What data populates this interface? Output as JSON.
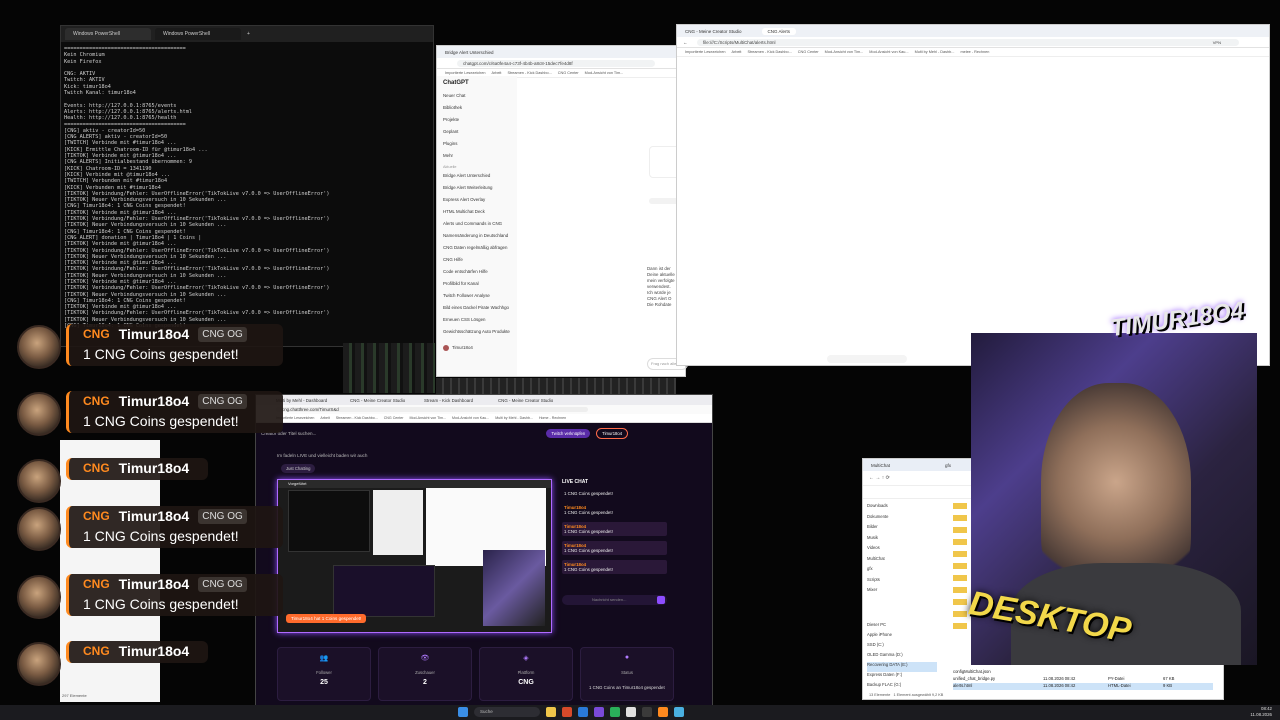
{
  "powershell": {
    "tab1": "Windows PowerShell",
    "tab2": "Windows PowerShell",
    "lines": "=======================================\nKein Chromium\nKein Firefox\n\nCNG: AKTIV\nTwitch: AKTIV\nKick: timur18o4\nTwitch Kanal: timur18o4\n\nEvents: http://127.0.0.1:8765/events\nAlerts: http://127.0.0.1:8765/alerts.html\nHealth: http://127.0.0.1:8765/health\n=======================================\n[CNG] aktiv - creatorId=50\n[CNG ALERTS] aktiv - creatorId=50\n[TWITCH] Verbinde mit #timur18o4 ...\n[KICK] Ermittle Chatroom-ID für @timur18o4 ...\n[TIKTOK] Verbinde mit @timur18o4 ...\n[CNG ALERTS] Initialbestand übernommen: 9\n[KICK] Chatroom-ID = 1341190\n[KICK] Verbinde mit @timur18o4 ...\n[TWITCH] Verbunden mit #timur18o4\n[KICK] Verbunden mit #timur18o4\n[TIKTOK] Verbindung/Fehler: UserOfflineError('TikTokLive v7.0.0 => UserOfflineError')\n[TIKTOK] Neuer Verbindungsversuch in 10 Sekunden ...\n[CNG] Timur18o4: 1 CNG Coins gespendet!\n[TIKTOK] Verbinde mit @timur18o4 ...\n[TIKTOK] Verbindung/Fehler: UserOfflineError('TikTokLive v7.0.0 => UserOfflineError')\n[TIKTOK] Neuer Verbindungsversuch in 10 Sekunden ...\n[CNG] Timur18o4: 1 CNG Coins gespendet!\n[CNG ALERT] donation | Timur18o4 | 1 Coins |\n[TIKTOK] Verbinde mit @timur18o4 ...\n[TIKTOK] Verbindung/Fehler: UserOfflineError('TikTokLive v7.0.0 => UserOfflineError')\n[TIKTOK] Neuer Verbindungsversuch in 10 Sekunden ...\n[TIKTOK] Verbinde mit @timur18o4 ...\n[TIKTOK] Verbindung/Fehler: UserOfflineError('TikTokLive v7.0.0 => UserOfflineError')\n[TIKTOK] Neuer Verbindungsversuch in 10 Sekunden ...\n[TIKTOK] Verbinde mit @timur18o4 ...\n[TIKTOK] Verbindung/Fehler: UserOfflineError('TikTokLive v7.0.0 => UserOfflineError')\n[TIKTOK] Neuer Verbindungsversuch in 10 Sekunden ...\n[CNG] Timur18o4: 1 CNG Coins gespendet!\n[TIKTOK] Verbinde mit @timur18o4 ...\n[TIKTOK] Verbindung/Fehler: UserOfflineError('TikTokLive v7.0.0 => UserOfflineError')\n[TIKTOK] Neuer Verbindungsversuch in 10 Sekunden ...\n[CNG] Timur18o4: 1 CNG Coins gespendet!"
  },
  "chatgpt": {
    "tab": "Bridge Alert Unterschied",
    "url": "chatgpt.com/c/6a0fe4a4-c73f-4b4b-a8c8-15dec7fe4d8f",
    "bookmarks": [
      "Importierte Lesezeichen",
      "Arbeit",
      "Streamen - Kick Dashbo...",
      "CNG Center",
      "Mod-Ansicht von Tim..."
    ],
    "brand": "ChatGPT",
    "menu": [
      "Neuer Chat",
      "Bibliothek",
      "Projekte",
      "Geplant",
      "Plugins",
      "Mehr"
    ],
    "section": "Aktuelle",
    "chats": [
      "Bridge Alert Unterschied",
      "Bridge Alert Weiterleitung",
      "Express Alert Overlay",
      "HTML Multichat Deck",
      "Alerts und Commands in CNG",
      "Namensänderung in Deutschland",
      "CNG Daten regelmäßig abfragen",
      "CNG Hilfe",
      "Code entschärfen Hilfe",
      "Profilbild für Kanal",
      "Twitch Follower Analyse",
      "Bild eines Dackel Pirate Wachhgo",
      "Erneuen CSS Lösgen",
      "Gewichtsschätzung Auto Produkte"
    ],
    "user": "Timur18o4",
    "snippet": [
      "Dann ist der",
      "Deine aktuelle",
      "mein verfolgte",
      "verwendest.",
      "Ich würde je",
      "CNG Alert O",
      "Die Rohdate"
    ],
    "input_placeholder": "Frag nach allem"
  },
  "alerts_browser": {
    "tab1": "CNG - Meine Creator Studio",
    "tab2": "CNG Alerts",
    "url": "file:///C:/Scripts/MultiChat/alerts.html",
    "bookmarks": [
      "Importierte Lesezeichen",
      "Arbeit",
      "Streamen - Kick Dashbo...",
      "CNG Center",
      "Mod-Ansicht von Tim...",
      "Mod-Ansicht von Kau...",
      "Multi by Mehl - Dashb...",
      "melee - Rechnen"
    ],
    "addon": "VPN"
  },
  "dashboard": {
    "tabs": [
      "Multi by Mehl - Dashboard",
      "CNG - Meine Creator Studio",
      "Stream - Kick Dashboard",
      "CNG - Meine Creator Studio"
    ],
    "url": "cng.chatthree.com/TimurS&d",
    "bookmarks": [
      "Importierte Lesezeichen",
      "Arbeit",
      "Streamen - Kick Dashbo...",
      "CNG Center",
      "Mod-Ansicht von Tim...",
      "Mod-Ansicht von Kau...",
      "Multi by Mehl - Dashb...",
      "Home - Rechnen"
    ],
    "search_placeholder": "Creator oder Titel suchen...",
    "creator_btn": "Twitch verknüpfen",
    "user": "Timur18o4",
    "stream_desc": "Im fadeln LIVE und vielleicht baden wir auch",
    "category": "Just Chatting",
    "preview_label": "Vorgeführt",
    "preview_overlay": "Timur18o4 hat 1 Coins gespendet!",
    "live_chat_title": "LIVE CHAT",
    "chat": [
      {
        "msg": "1 CNG Coins gespendet!"
      },
      {
        "name": "Timur18o4",
        "msg": "1 CNG Coins gespendet!"
      },
      {
        "name": "Timur18o4",
        "msg": "1 CNG Coins gespendet!"
      },
      {
        "name": "Timur18o4",
        "msg": "1 CNG Coins gespendet!"
      },
      {
        "name": "Timur18o4",
        "msg": "1 CNG Coins gespendet!"
      }
    ],
    "chat_placeholder": "Nachricht senden...",
    "stats": [
      {
        "label": "Follower",
        "value": "25"
      },
      {
        "label": "Zuschauer",
        "value": "2"
      },
      {
        "label": "Plattform",
        "value": "CNG"
      },
      {
        "label": "Status",
        "value": ""
      }
    ],
    "toast": "1 CNG Coins an Timur18o4 gespendet"
  },
  "explorer": {
    "title": "MultiChat",
    "tab2": "gfx",
    "nav": [
      "Downloads",
      "Dokumente",
      "Bilder",
      "Musik",
      "Videos",
      "MultiChat",
      "gfx",
      "Scripts",
      "Mixer"
    ],
    "tree": [
      "Dieser PC",
      "Apple iPhone",
      "SSD (C:)",
      "OLED Gamma (D:)",
      "Recovering DATA (E:)",
      "Express Daten (F:)",
      "Backup FLAC (G:)"
    ],
    "files": [
      {
        "name": "configMultiChat.json",
        "date": "",
        "type": "",
        "size": ""
      },
      {
        "name": "unified_chat_bridge.py",
        "date": "11.08.2026 08:42",
        "type": "PY-Datei",
        "size": "67 KB"
      },
      {
        "name": "alerts.html",
        "date": "11.08.2026 08:42",
        "type": "HTML-Datei",
        "size": "9 KB"
      }
    ],
    "status": "13 Elemente",
    "status2": "1 Element ausgewählt 9,2 KB"
  },
  "cam_overlay": {
    "top_text": "TIMUR18O4",
    "bottom_text": "DESKTOP"
  },
  "notifications": [
    {
      "tag": "CNG",
      "name": "Timur18o4",
      "badge": "CNG OG",
      "text": "1 CNG Coins gespendet!"
    },
    {
      "tag": "CNG",
      "name": "Timur18o4",
      "badge": "CNG OG",
      "text": "1 CNG Coins gespendet!"
    },
    {
      "tag": "CNG",
      "name": "Timur18o4",
      "badge": "",
      "text": ""
    },
    {
      "tag": "CNG",
      "name": "Timur18o4",
      "badge": "CNG OG",
      "text": "1 CNG Coins gespendet!"
    },
    {
      "tag": "CNG",
      "name": "Timur18o4",
      "badge": "CNG OG",
      "text": "1 CNG Coins gespendet!"
    },
    {
      "tag": "CNG",
      "name": "Timur18o4",
      "badge": "",
      "text": ""
    }
  ],
  "taskbar": {
    "search": "Suche",
    "time": "08:42",
    "date": "11.08.2026"
  },
  "left_status": "297 Elemente",
  "colors": {
    "accent_orange": "#ff8a1f",
    "accent_purple": "#a66bff"
  }
}
